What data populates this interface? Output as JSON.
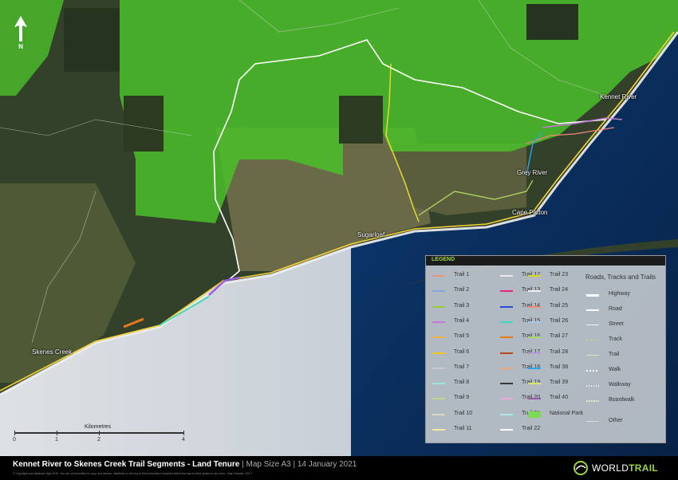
{
  "map": {
    "places": [
      "Kennet River",
      "Grey River",
      "Cape Patton",
      "Sugarloaf",
      "Skenes Creek"
    ],
    "north_label": "N",
    "scale": {
      "title": "Kilometres",
      "ticks": [
        "0",
        "1",
        "2",
        "4"
      ]
    }
  },
  "legend": {
    "title": "LEGEND",
    "trails": [
      {
        "label": "Trail 1",
        "color": "#e9967a"
      },
      {
        "label": "Trail 2",
        "color": "#7fa8d8"
      },
      {
        "label": "Trail 3",
        "color": "#9ccc3c"
      },
      {
        "label": "Trail 4",
        "color": "#c27ad8"
      },
      {
        "label": "Trail 5",
        "color": "#f2b24a"
      },
      {
        "label": "Trail 6",
        "color": "#f2c818"
      },
      {
        "label": "Trail 7",
        "color": "#c8c8d8"
      },
      {
        "label": "Trail 8",
        "color": "#9ce6d8"
      },
      {
        "label": "Trail 9",
        "color": "#bcd88c"
      },
      {
        "label": "Trail 10",
        "color": "#d8d8c0"
      },
      {
        "label": "Trail 11",
        "color": "#f8e8a0"
      },
      {
        "label": "Trail 12",
        "color": "#e8e8f0"
      },
      {
        "label": "Trail 13",
        "color": "#e8247c"
      },
      {
        "label": "Trail 14",
        "color": "#2848d8"
      },
      {
        "label": "Trail 15",
        "color": "#38d8b8"
      },
      {
        "label": "Trail 16",
        "color": "#e87818"
      },
      {
        "label": "Trail 17",
        "color": "#b84818"
      },
      {
        "label": "Trail 18",
        "color": "#e8a878"
      },
      {
        "label": "Trail 19",
        "color": "#383838"
      },
      {
        "label": "Trail 20",
        "color": "#e8a8d8"
      },
      {
        "label": "Trail 21",
        "color": "#a8e8e8"
      },
      {
        "label": "Trail 22",
        "color": "#ffffff"
      },
      {
        "label": "Trail 23",
        "color": "#d8d818"
      },
      {
        "label": "Trail 24",
        "color": "#f0f0f0"
      },
      {
        "label": "Trail 25",
        "color": "#f08878"
      },
      {
        "label": "Trail 26",
        "color": "#a8c8e8"
      },
      {
        "label": "Trail 27",
        "color": "#a8d868"
      },
      {
        "label": "Trail 28",
        "color": "#b898d8"
      },
      {
        "label": "Trail 38",
        "color": "#28a8e8"
      },
      {
        "label": "Trail 39",
        "color": "#d8e868"
      },
      {
        "label": "Trail 40",
        "color": "#9858a8"
      },
      {
        "label": "National Park",
        "color": "#7ed957"
      }
    ],
    "roads_title": "Roads, Tracks and Trails",
    "roads": [
      {
        "label": "Highway",
        "style": "highway"
      },
      {
        "label": "Road",
        "style": "road"
      },
      {
        "label": "Street",
        "style": "street"
      },
      {
        "label": "Track",
        "style": "track"
      },
      {
        "label": "Trail",
        "style": "trail"
      },
      {
        "label": "Walk",
        "style": "walk"
      },
      {
        "label": "Walkway",
        "style": "walkway"
      },
      {
        "label": "Boardwalk",
        "style": "boardwalk"
      },
      {
        "label": "Other",
        "style": "other"
      }
    ]
  },
  "footer": {
    "title": "Kennet River to Skenes Creek Trail Segments - Land Tenure",
    "map_size": "Map Size A3",
    "date": "14 January 2021",
    "copyright": "© Copyright and database right 2019. You are not permitted to copy, sub-licence, distribute or sell any of this information compiled within the map to third parties in any form. | Map Number: 002.7",
    "logo_text_a": "WORLD",
    "logo_text_b": "TRAIL"
  },
  "colors": {
    "national_park": "#4bbf2a",
    "ocean_deep": "#0a2a5c",
    "ocean_light": "#d9dde2",
    "land": "#3b4a2a",
    "brand": "#9ad24a"
  }
}
